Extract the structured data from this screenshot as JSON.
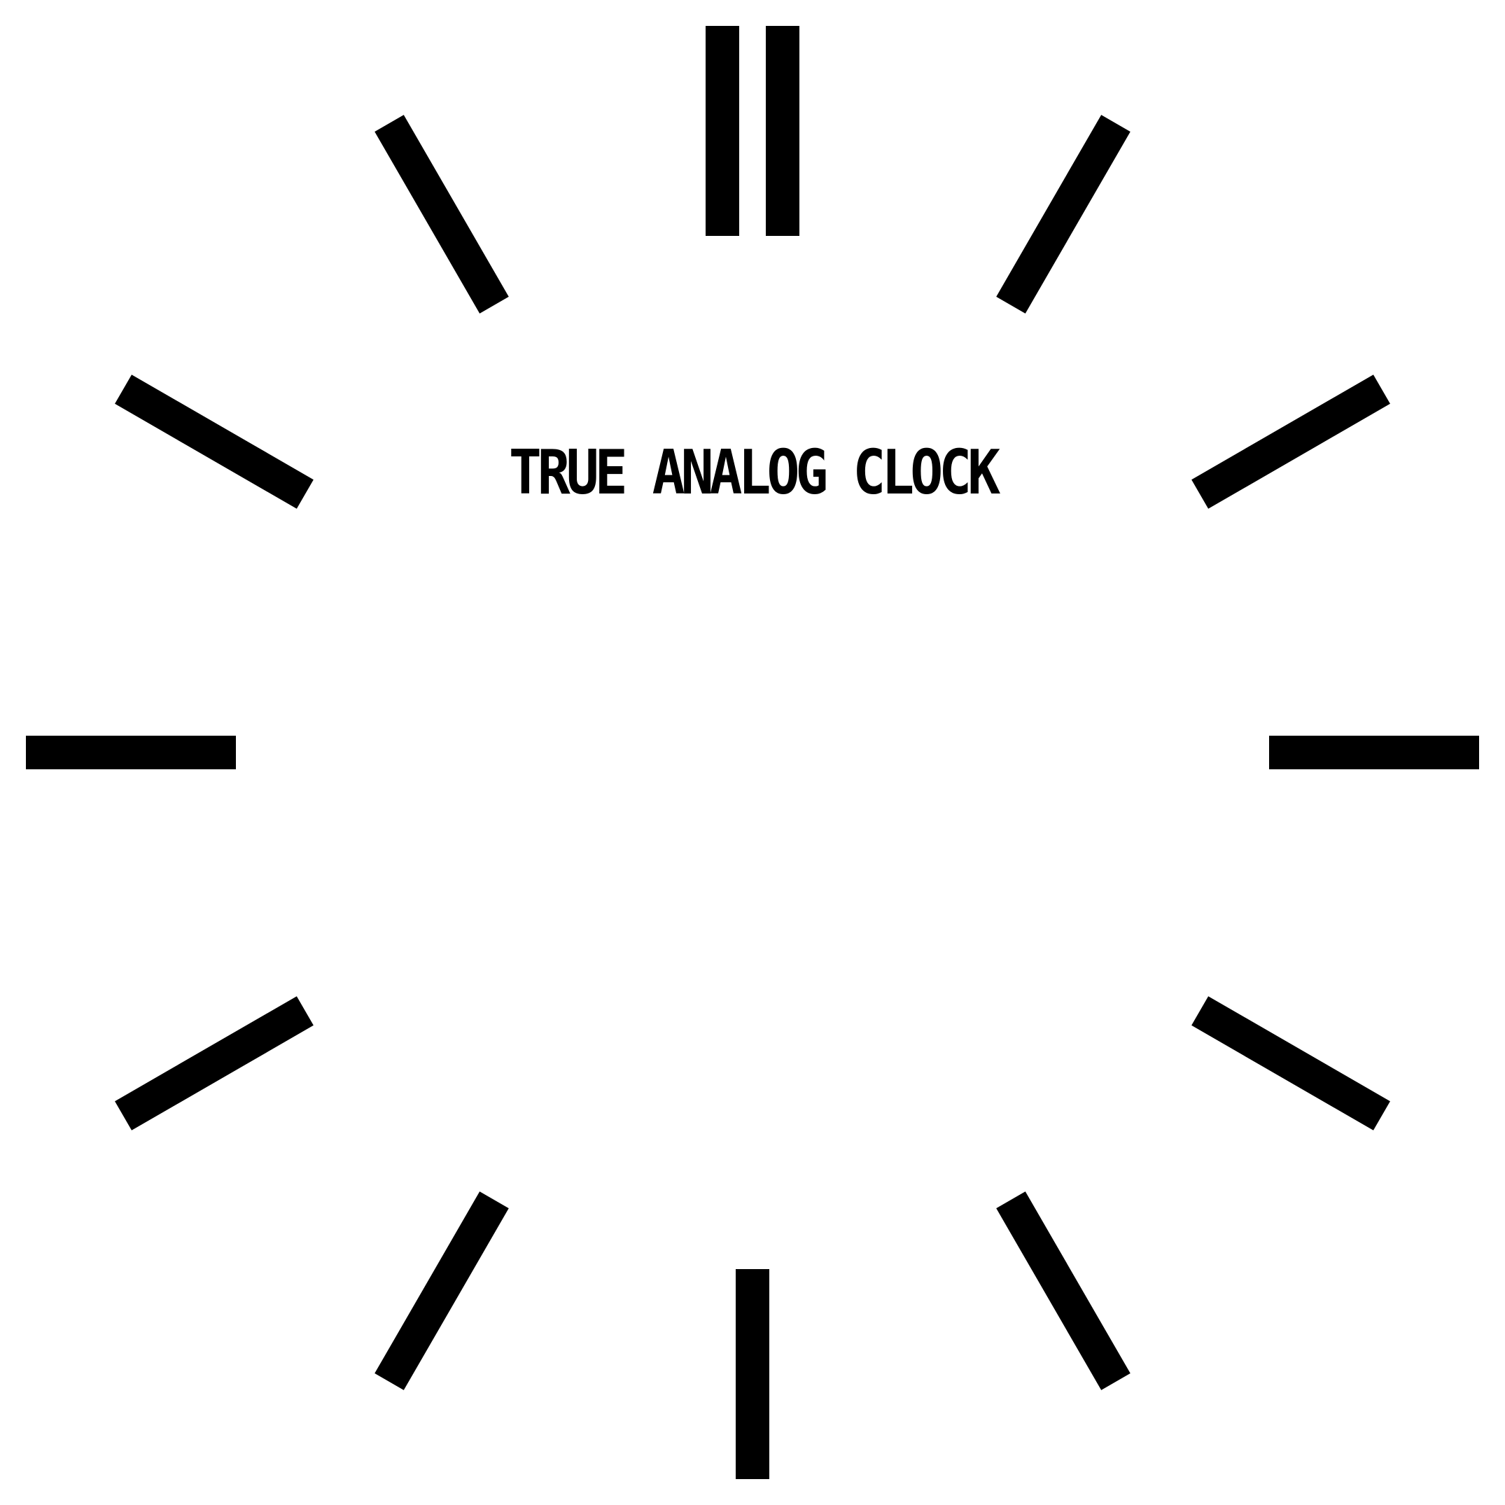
{
  "brand": {
    "label": "TRUE ANALOG CLOCK"
  },
  "dial": {
    "tick_color": "#000000",
    "background_color": "#ffffff",
    "hour_markers": [
      {
        "hour": 12,
        "double": true
      },
      {
        "hour": 1,
        "double": false
      },
      {
        "hour": 2,
        "double": false
      },
      {
        "hour": 3,
        "double": false
      },
      {
        "hour": 4,
        "double": false
      },
      {
        "hour": 5,
        "double": false
      },
      {
        "hour": 6,
        "double": false
      },
      {
        "hour": 7,
        "double": false
      },
      {
        "hour": 8,
        "double": false
      },
      {
        "hour": 9,
        "double": false
      },
      {
        "hour": 10,
        "double": false
      },
      {
        "hour": 11,
        "double": false
      }
    ]
  }
}
